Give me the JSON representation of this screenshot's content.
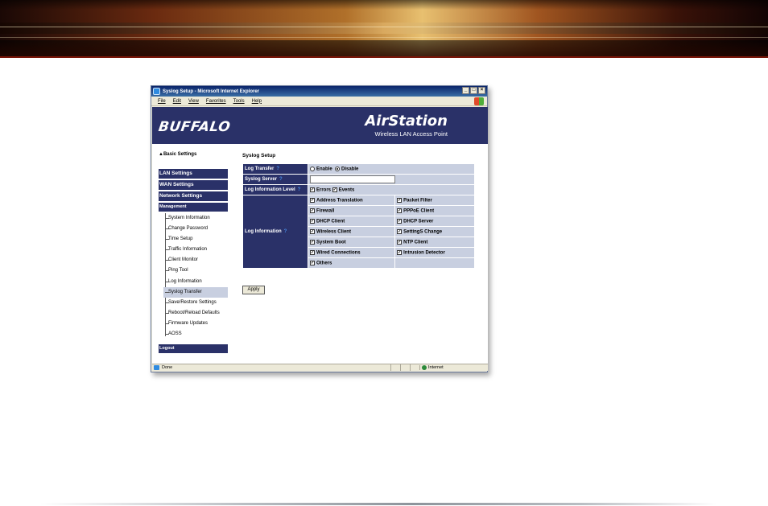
{
  "window": {
    "title": "Syslog Setup - Microsoft Internet Explorer",
    "controls": [
      "_",
      "□",
      "×"
    ],
    "menu": [
      "File",
      "Edit",
      "View",
      "Favorites",
      "Tools",
      "Help"
    ]
  },
  "header": {
    "brand": "BUFFALO",
    "product": "AirStation",
    "product_sub": "Wireless LAN Access Point",
    "bg_color": "#2a3168"
  },
  "nav": {
    "basic_settings": "▲Basic Settings",
    "sections": [
      "LAN Settings",
      "WAN Settings",
      "Network Settings",
      "Management"
    ],
    "management_items": [
      "System Information",
      "Change Password",
      "Time Setup",
      "Traffic Information",
      "Client Monitor",
      "Ping Tool",
      "Log Information",
      "Syslog Transfer",
      "Save/Restore Settings",
      "Reboot/Reload Defaults",
      "Firmware Updates",
      "AOSS"
    ],
    "active_item": "Syslog Transfer",
    "logout": "Logout"
  },
  "main": {
    "title": "Syslog Setup",
    "log_transfer": {
      "label": "Log Transfer",
      "options": [
        "Enable",
        "Disable"
      ],
      "selected": "Disable"
    },
    "syslog_server": {
      "label": "Syslog Server",
      "value": ""
    },
    "log_level": {
      "label": "Log Information Level",
      "options": [
        "Errors",
        "Events"
      ],
      "checked": [
        true,
        true
      ]
    },
    "log_info": {
      "label": "Log Information",
      "left": [
        "Address Translation",
        "Firewall",
        "DHCP Client",
        "Wireless Client",
        "System Boot",
        "Wired Connections",
        "Others"
      ],
      "right": [
        "Packet Filter",
        "PPPoE Client",
        "DHCP Server",
        "SettingS Change",
        "NTP Client",
        "Intrusion Detector"
      ]
    },
    "apply": "Apply"
  },
  "status": {
    "text": "Done",
    "zone": "Internet"
  }
}
